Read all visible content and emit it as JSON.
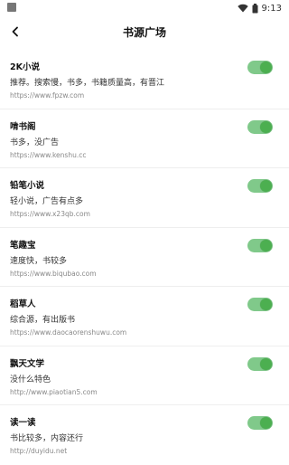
{
  "status_bar": {
    "time": "9:13"
  },
  "header": {
    "title": "书源广场"
  },
  "sources": [
    {
      "name": "2K小说",
      "description": "推荐。搜索慢，书多，书籍质量高，有晋江",
      "url": "https://www.fpzw.com",
      "enabled": true
    },
    {
      "name": "啃书阁",
      "description": "书多，没广告",
      "url": "https://www.kenshu.cc",
      "enabled": true
    },
    {
      "name": "铅笔小说",
      "description": "轻小说，广告有点多",
      "url": "https://www.x23qb.com",
      "enabled": true
    },
    {
      "name": "笔趣宝",
      "description": "速度快，书较多",
      "url": "https://www.biqubao.com",
      "enabled": true
    },
    {
      "name": "稻草人",
      "description": "综合源，有出版书",
      "url": "https://www.daocaorenshuwu.com",
      "enabled": true
    },
    {
      "name": "飘天文学",
      "description": "没什么特色",
      "url": "http://www.piaotian5.com",
      "enabled": true
    },
    {
      "name": "读一读",
      "description": "书比较多，内容还行",
      "url": "http://duyidu.net",
      "enabled": true
    }
  ],
  "colors": {
    "toggle_track": "#80c98a",
    "toggle_knob": "#4caf50"
  }
}
